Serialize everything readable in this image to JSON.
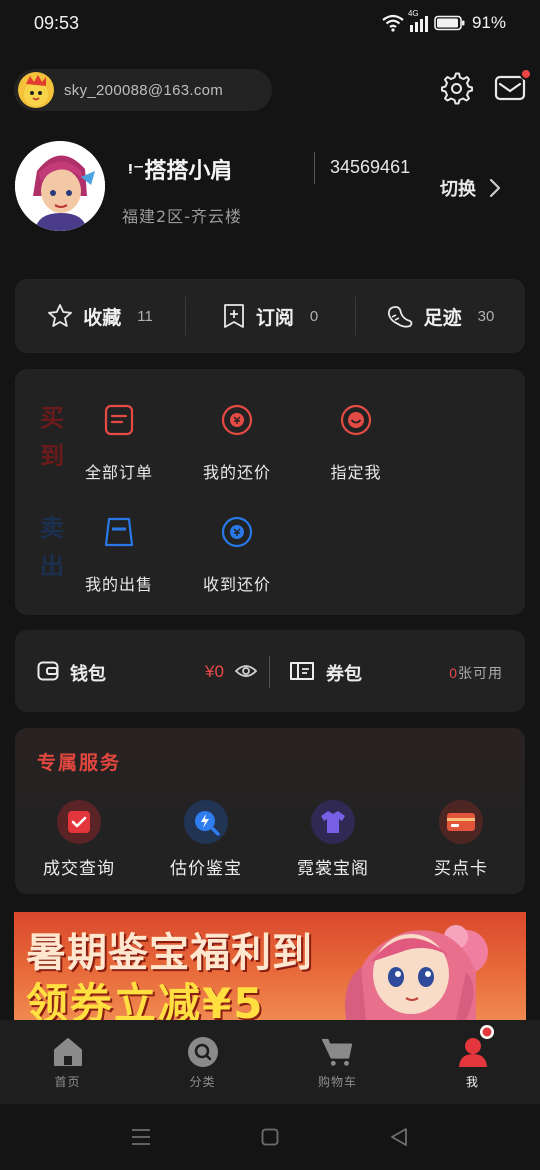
{
  "status": {
    "time": "09:53",
    "network": "4G",
    "battery": "91%"
  },
  "account": {
    "email": "sky_200088@163.com"
  },
  "profile": {
    "name": "ᵎ⁻搭搭小肩",
    "id": "34569461",
    "server": "福建2区-齐云楼",
    "switch_label": "切换"
  },
  "stats": [
    {
      "label": "收藏",
      "count": "11",
      "icon": "star-icon"
    },
    {
      "label": "订阅",
      "count": "0",
      "icon": "subscribe-icon"
    },
    {
      "label": "足迹",
      "count": "30",
      "icon": "footprint-icon"
    }
  ],
  "orders": {
    "buy_tag": "买到",
    "sell_tag": "卖出",
    "buy_items": [
      {
        "label": "全部订单",
        "icon": "orders-icon"
      },
      {
        "label": "我的还价",
        "icon": "my-counteroffer-icon"
      },
      {
        "label": "指定我",
        "icon": "designated-icon"
      }
    ],
    "sell_items": [
      {
        "label": "我的出售",
        "icon": "my-sales-icon"
      },
      {
        "label": "收到还价",
        "icon": "received-counteroffer-icon"
      }
    ]
  },
  "wallet": {
    "wallet_label": "钱包",
    "wallet_amount": "¥0",
    "coupon_label": "券包",
    "coupon_count": "0",
    "coupon_suffix": "张可用"
  },
  "services": {
    "title": "专属服务",
    "items": [
      {
        "label": "成交查询",
        "icon": "deal-query-icon"
      },
      {
        "label": "估价鉴宝",
        "icon": "appraisal-icon"
      },
      {
        "label": "霓裳宝阁",
        "icon": "wardrobe-icon"
      },
      {
        "label": "买点卡",
        "icon": "point-card-icon"
      }
    ]
  },
  "banner": {
    "line1": "暑期鉴宝福利到",
    "line2": "领券立减¥5"
  },
  "tabs": [
    {
      "label": "首页",
      "icon": "home-icon"
    },
    {
      "label": "分类",
      "icon": "category-search-icon"
    },
    {
      "label": "购物车",
      "icon": "cart-icon"
    },
    {
      "label": "我",
      "icon": "profile-icon"
    }
  ],
  "colors": {
    "accent_red": "#ea4a4a",
    "accent_blue": "#1f6fe0",
    "background": "#141414",
    "card": "#222222"
  }
}
